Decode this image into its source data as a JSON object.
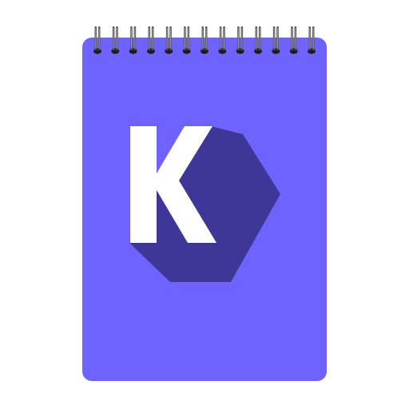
{
  "logo": {
    "letter": "K"
  },
  "icon": {
    "name": "notepad-app-icon"
  },
  "colors": {
    "notebook": "#6f63ff",
    "shadow": "#3e3797",
    "letter": "#ffffff",
    "ring": "#555555",
    "ring_highlight": "#9a9a9a",
    "hole": "#1d1d1d"
  },
  "spiral": {
    "ring_count": 13
  }
}
